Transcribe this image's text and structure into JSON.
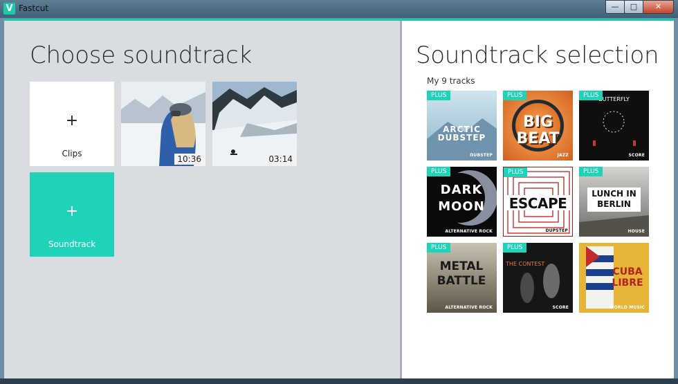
{
  "window": {
    "title": "Fastcut",
    "logo_letter": "V",
    "min": "—",
    "max": "□",
    "close": "✕"
  },
  "left": {
    "title": "Choose soundtrack",
    "clips_tile": {
      "plus": "+",
      "label": "Clips"
    },
    "soundtrack_tile": {
      "plus": "+",
      "label": "Soundtrack"
    },
    "clips": [
      {
        "duration": "10:36"
      },
      {
        "duration": "03:14"
      }
    ]
  },
  "right": {
    "title": "Soundtrack selection",
    "subtitle": "My 9 tracks",
    "badge": "PLUS",
    "tracks": [
      {
        "title": "ARCTIC DUBSTEP",
        "genre": "DUBSTEP"
      },
      {
        "title": "BIG BEAT",
        "genre": "JAZZ"
      },
      {
        "title": "BUTTERFLY",
        "genre": "SCORE"
      },
      {
        "title": "DARK MOON",
        "genre": "ALTERNATIVE ROCK"
      },
      {
        "title": "ESCAPE",
        "genre": "DUPSTEP"
      },
      {
        "title": "LUNCH IN BERLIN",
        "genre": "HOUSE"
      },
      {
        "title": "METAL BATTLE",
        "genre": "ALTERNATIVE ROCK"
      },
      {
        "title": "THE CONTEST",
        "genre": "SCORE"
      },
      {
        "title": "CUBA LIBRE",
        "genre": "WORLD MUSIC"
      }
    ]
  },
  "colors": {
    "accent": "#1fd3b8",
    "left_bg": "#d9dde2"
  }
}
